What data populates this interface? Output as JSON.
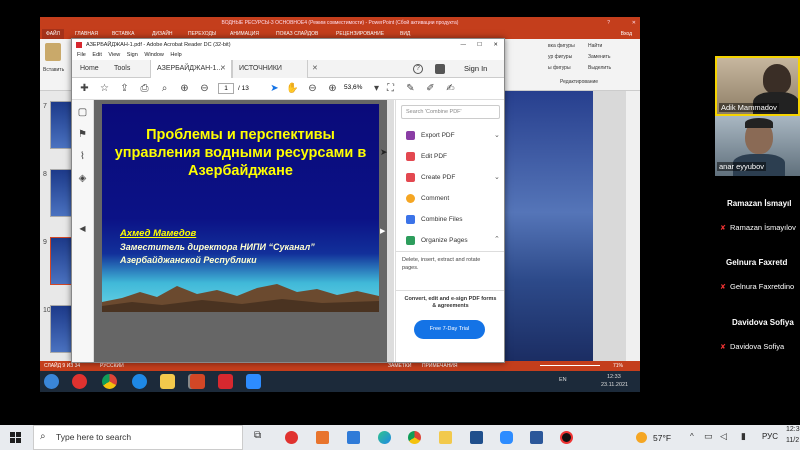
{
  "powerpoint": {
    "title": "ВОДНЫЕ РЕСУРСЫ-3 ОСНОВНОЕ4 (Режим совместимости) - PowerPoint (Сбой активации продукта)",
    "sign_in": "Вход",
    "ribbon_tabs": [
      "ФАЙЛ",
      "ГЛАВНАЯ",
      "ВСТАВКА",
      "ДИЗАЙН",
      "ПЕРЕХОДЫ",
      "АНИМАЦИЯ",
      "ПОКАЗ СЛАЙДОВ",
      "РЕЦЕНЗИРОВАНИЕ",
      "ВИД"
    ],
    "paste_label": "Вставить",
    "ribbon_right": [
      "Найти",
      "Заменить",
      "Выделить"
    ],
    "shape_items": [
      "вка фигуры",
      "ур фигуры",
      "ы фигуры"
    ],
    "editing_group": "Редактирование",
    "thumb_numbers": [
      "7",
      "8",
      "9",
      "10"
    ],
    "status_left": "СЛАЙД 9 ИЗ 34",
    "status_lang": "РУССКИЙ",
    "status_notes": "ЗАМЕТКИ",
    "status_comments": "ПРИМЕЧАНИЯ",
    "zoom": "71%",
    "tray_lang": "EN",
    "tray_time": "12:33",
    "tray_date": "23.11.2021"
  },
  "acrobat": {
    "title": "АЗЕРБАЙДЖАН-1.pdf - Adobe Acrobat Reader DC (32-bit)",
    "menu": [
      "File",
      "Edit",
      "View",
      "Sign",
      "Window",
      "Help"
    ],
    "tabs": [
      "Home",
      "Tools",
      "АЗЕРБАЙДЖАН-1...",
      "ИСТОЧНИКИ ЗАГР..."
    ],
    "sign_in": "Sign In",
    "page_current": "1",
    "page_total": "/ 13",
    "zoom": "53,6%",
    "search_placeholder": "Search 'Combine PDF'",
    "right_tools": [
      "Export PDF",
      "Edit PDF",
      "Create PDF",
      "Comment",
      "Combine Files",
      "Organize Pages"
    ],
    "organize_desc": "Delete, insert, extract and rotate pages.",
    "promo_text": "Convert, edit and e-sign PDF forms & agreements",
    "trial_button": "Free 7-Day Trial",
    "slide": {
      "title": "Проблемы и перспективы управления водными ресурсами в Азербайджане",
      "author": "Ахмед Мамедов",
      "role_line1": "Заместитель директора НИПИ “Суканал”",
      "role_line2": "Азербайджанской Республики"
    }
  },
  "participants": [
    {
      "name": "Adik Mammadov",
      "type": "video"
    },
    {
      "name": "anar eyyubov",
      "type": "video"
    },
    {
      "name_big": "Ramazan İsmayıl",
      "name_small": "Ramazan İsmayılov",
      "muted": true
    },
    {
      "name_big": "Gelnura Faxretd",
      "name_small": "Gelnura Faxretdino",
      "muted": true
    },
    {
      "name_big": "Davidova Sofiya",
      "name_small": "Davidova Sofiya",
      "muted": true
    }
  ],
  "windows": {
    "search_placeholder": "Type here to search",
    "weather": "57°F",
    "lang": "РУС",
    "time": "12:3",
    "date": "11/2"
  },
  "colors": {
    "ppt_accent": "#c43e1c",
    "acrobat_red": "#d7282f",
    "trial_button": "#1473e6",
    "slide_yellow": "#ffff00"
  }
}
